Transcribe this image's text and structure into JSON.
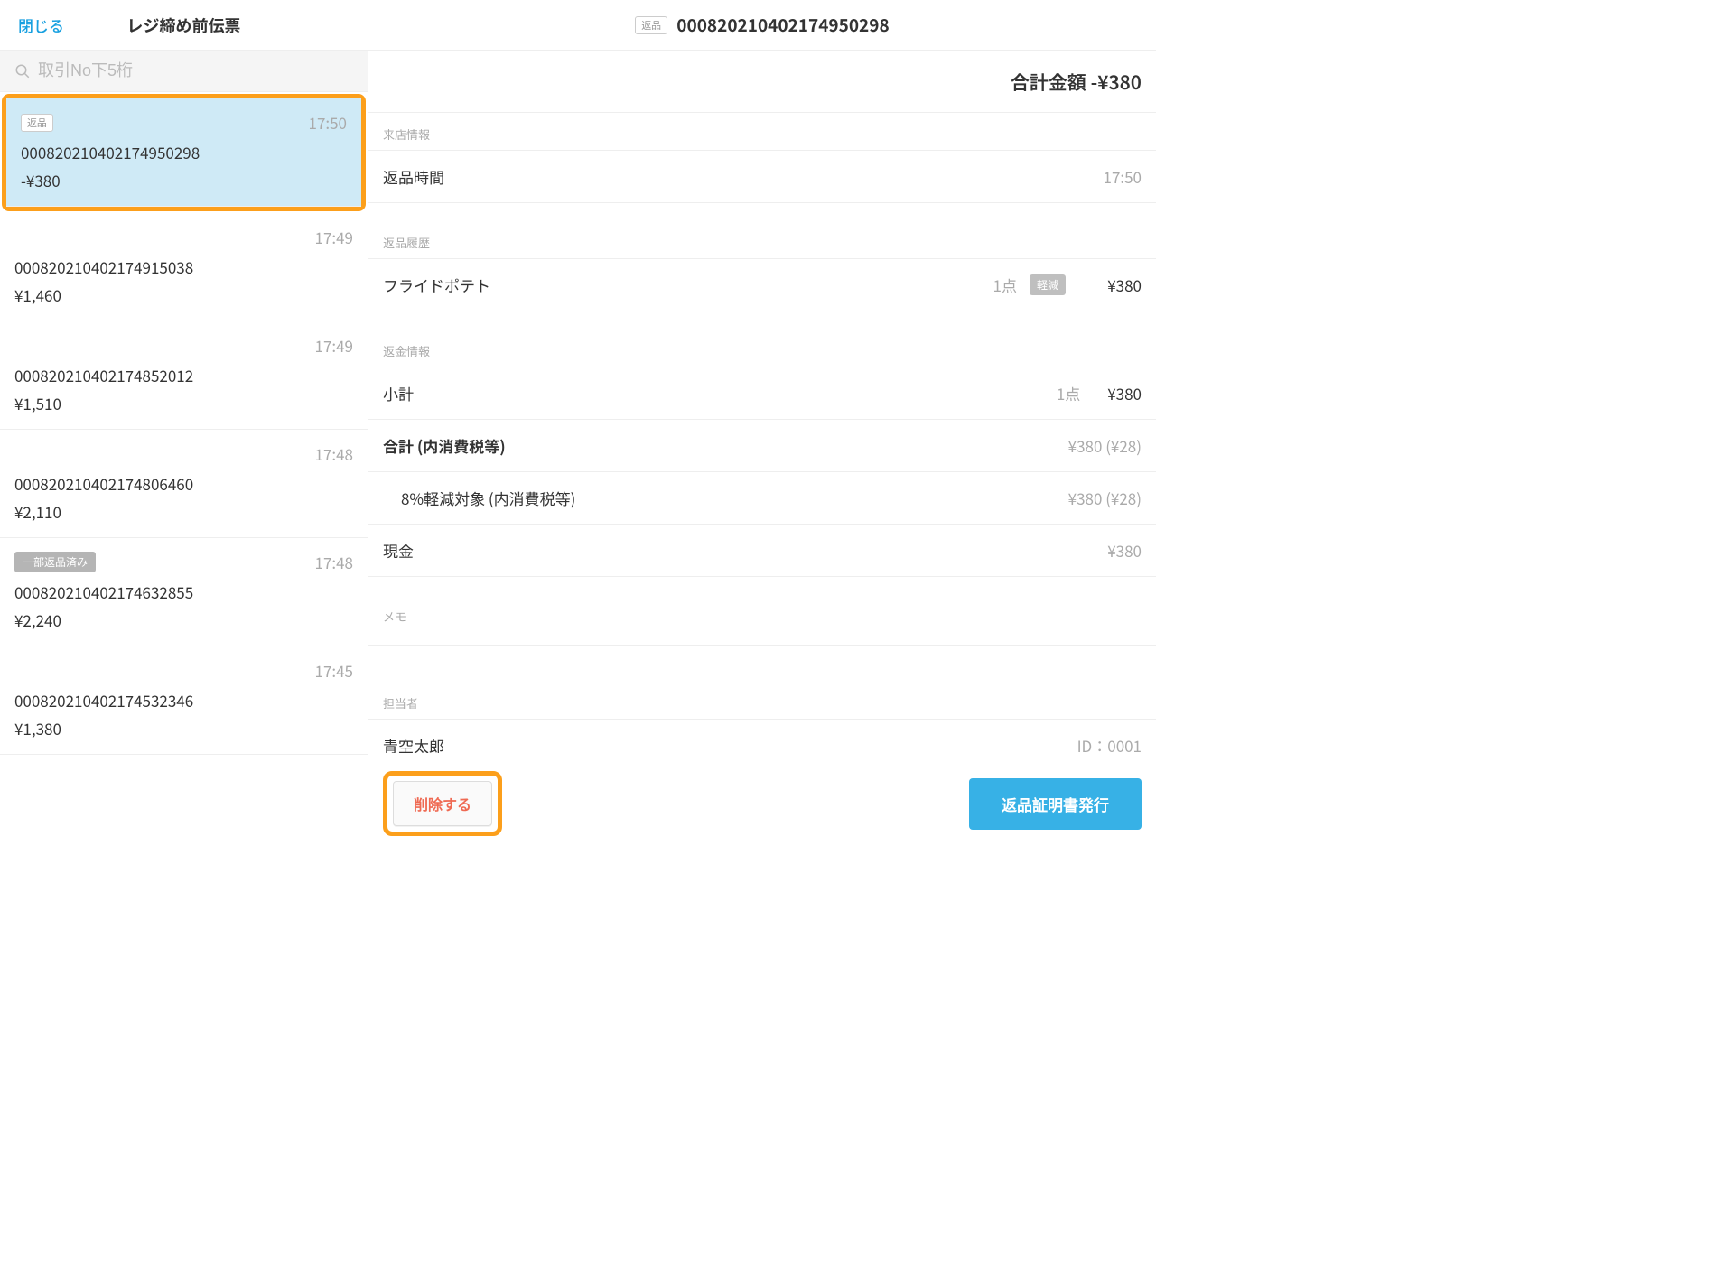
{
  "left": {
    "close_label": "閉じる",
    "title": "レジ締め前伝票",
    "search_placeholder": "取引No下5桁",
    "items": [
      {
        "badge": "返品",
        "badge_style": "outline",
        "time": "17:50",
        "id": "000820210402174950298",
        "amount": "-¥380",
        "selected": true,
        "highlighted": true
      },
      {
        "badge": "",
        "time": "17:49",
        "id": "000820210402174915038",
        "amount": "¥1,460"
      },
      {
        "badge": "",
        "time": "17:49",
        "id": "000820210402174852012",
        "amount": "¥1,510"
      },
      {
        "badge": "",
        "time": "17:48",
        "id": "000820210402174806460",
        "amount": "¥2,110"
      },
      {
        "badge": "一部返品済み",
        "badge_style": "fill",
        "time": "17:48",
        "id": "000820210402174632855",
        "amount": "¥2,240"
      },
      {
        "badge": "",
        "time": "17:45",
        "id": "000820210402174532346",
        "amount": "¥1,380"
      }
    ]
  },
  "right": {
    "header_badge": "返品",
    "header_id": "000820210402174950298",
    "total_label": "合計金額",
    "total_amount": "-¥380",
    "sections": {
      "visit_label": "来店情報",
      "return_time_label": "返品時間",
      "return_time_value": "17:50",
      "history_label": "返品履歴",
      "item": {
        "name": "フライドポテト",
        "qty": "1点",
        "tax_badge": "軽減",
        "price": "¥380"
      },
      "refund_label": "返金情報",
      "subtotal_label": "小計",
      "subtotal_qty": "1点",
      "subtotal_amount": "¥380",
      "grand_label": "合計 (内消費税等)",
      "grand_amount": "¥380 (¥28)",
      "tax8_label": "8%軽減対象 (内消費税等)",
      "tax8_amount": "¥380 (¥28)",
      "cash_label": "現金",
      "cash_amount": "¥380",
      "memo_label": "メモ",
      "staff_label": "担当者",
      "staff_name": "青空太郎",
      "staff_id": "ID：0001"
    },
    "footer": {
      "delete_label": "削除する",
      "cert_label": "返品証明書発行"
    }
  }
}
